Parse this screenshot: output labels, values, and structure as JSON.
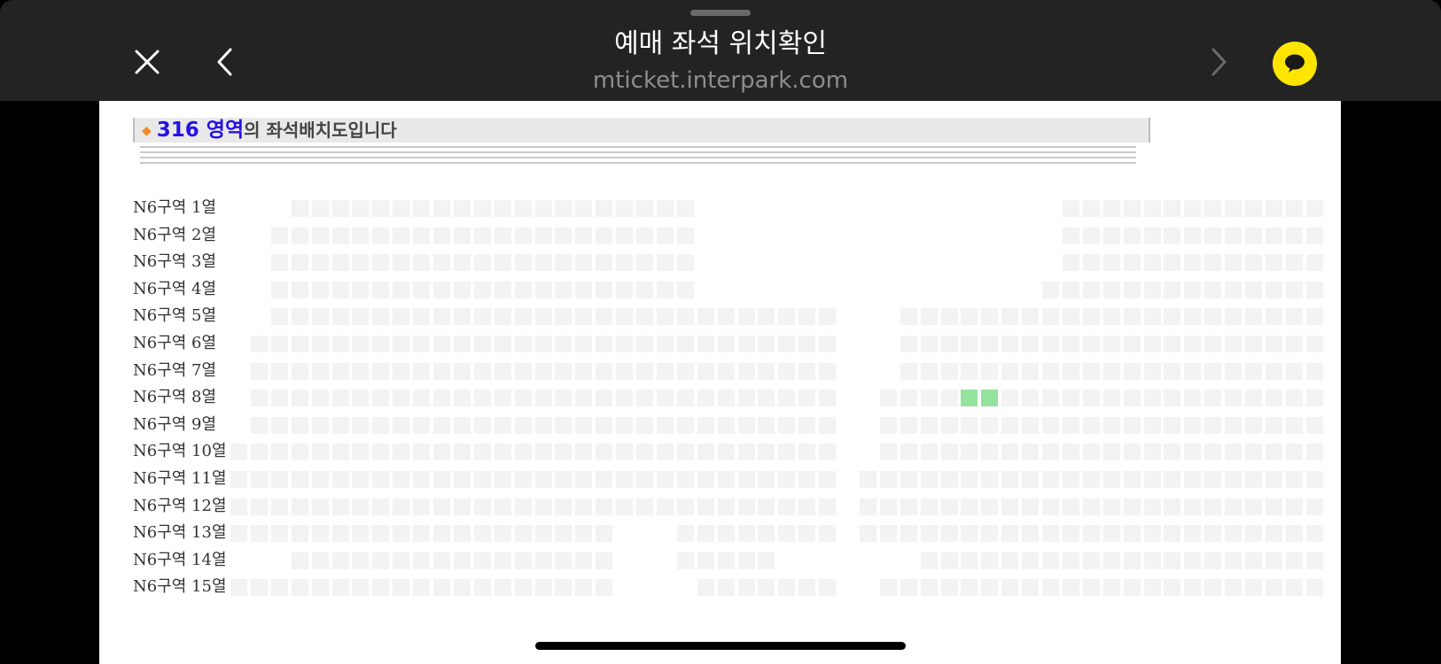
{
  "appbar": {
    "title": "예매 좌석 위치확인",
    "url": "mticket.interpark.com",
    "close_icon": "close-icon",
    "back_icon": "chevron-left-icon",
    "forward_icon": "chevron-right-icon",
    "talk_icon": "kakaotalk-bubble-icon"
  },
  "header": {
    "bullet": "◆",
    "area_label": "316 영역",
    "suffix": "의 좌석배치도입니다"
  },
  "rows": [
    "N6구역 1열",
    "N6구역 2열",
    "N6구역 3열",
    "N6구역 4열",
    "N6구역 5열",
    "N6구역 6열",
    "N6구역 7열",
    "N6구역 8열",
    "N6구역 9열",
    "N6구역 10열",
    "N6구역 11열",
    "N6구역 12열",
    "N6구역 13열",
    "N6구역 14열",
    "N6구역 15열"
  ],
  "selected_seats": [
    {
      "row": "N6구역 8열",
      "seat_index": 4
    },
    {
      "row": "N6구역 8열",
      "seat_index": 5
    }
  ],
  "colors": {
    "appbar_bg": "#232323",
    "seat_available": "#f3f3f3",
    "seat_selected": "#93e39c",
    "area_text": "#2410e6",
    "bullet": "#f28c28",
    "talk_button": "#fee500"
  }
}
